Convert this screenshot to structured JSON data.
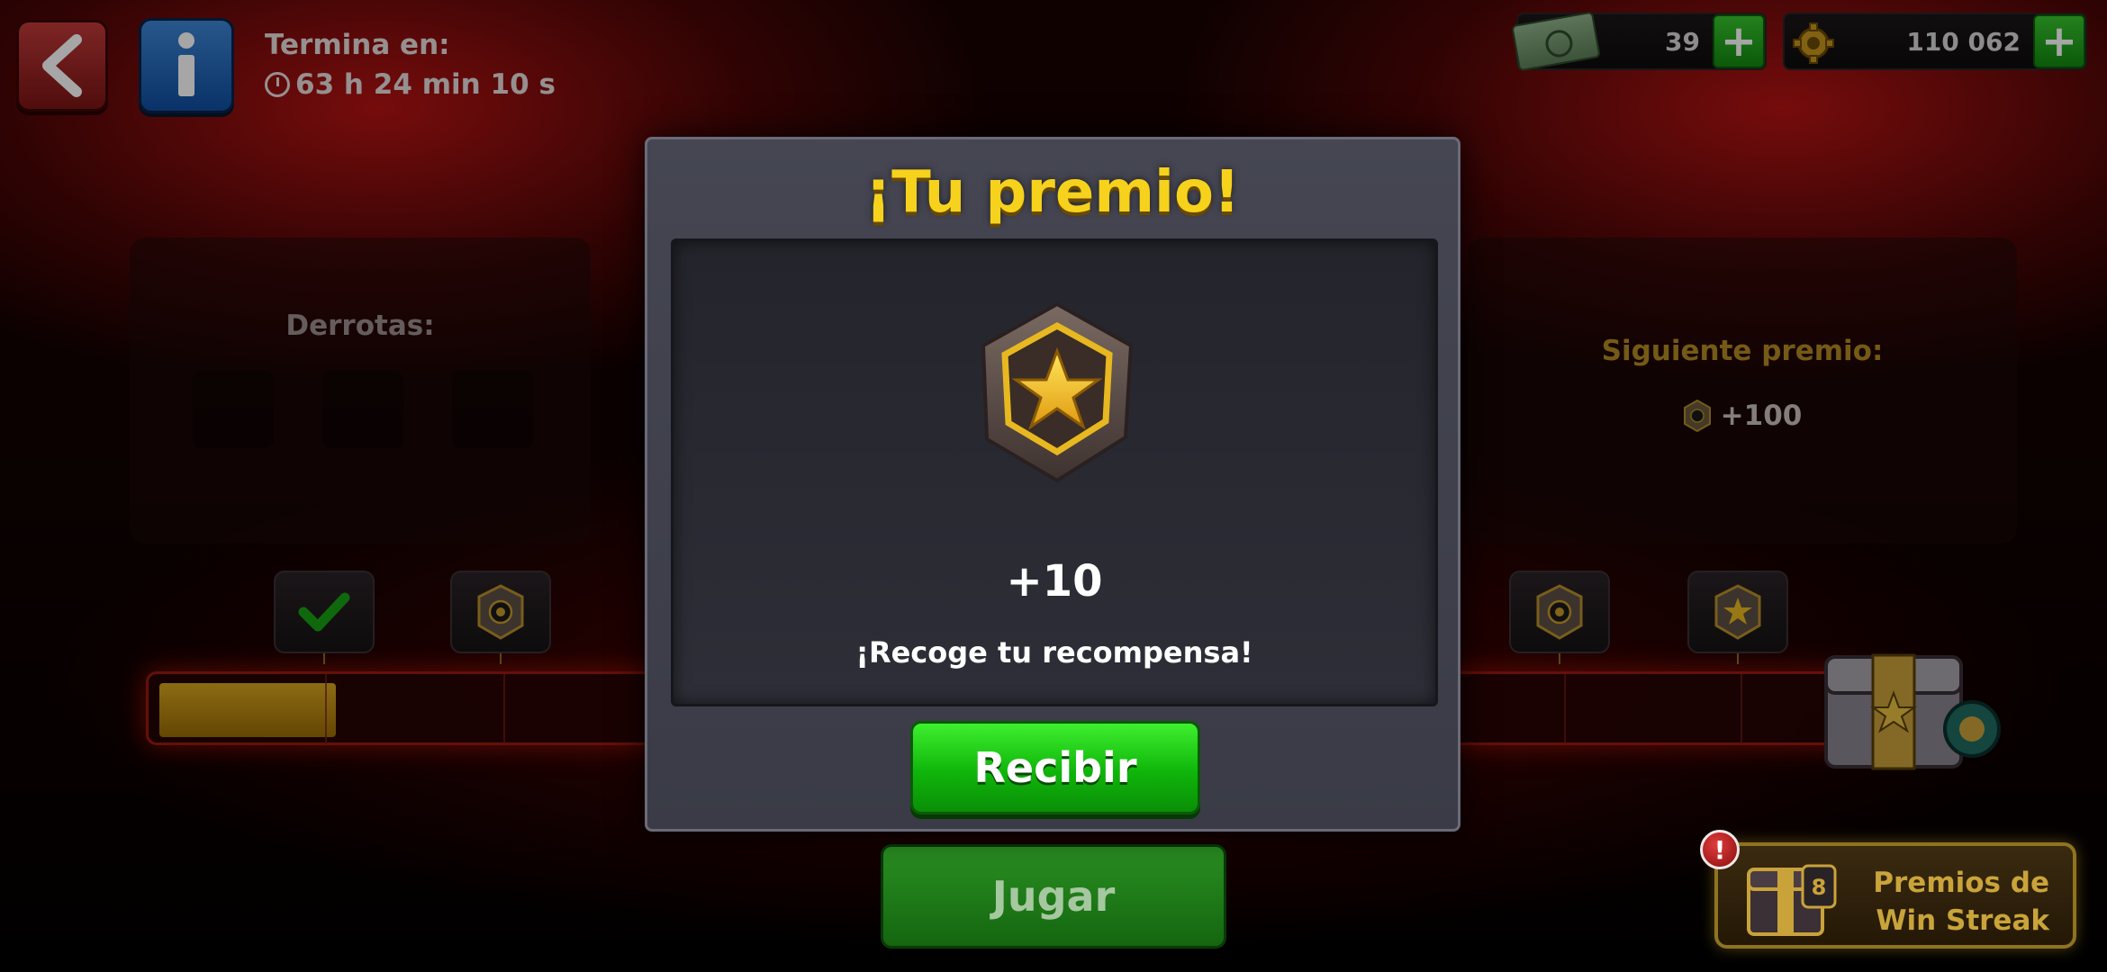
{
  "header": {
    "timer_label": "Termina en:",
    "timer_value": "63 h 24 min 10 s"
  },
  "currency": {
    "cash": "39",
    "coins": "110 062"
  },
  "left_panel": {
    "label": "Derrotas:"
  },
  "right_panel": {
    "label": "Siguiente premio:",
    "value": "+100"
  },
  "progress": {
    "filled_fraction": 0.07
  },
  "modal": {
    "title": "¡Tu premio!",
    "amount": "+10",
    "message": "¡Recoge tu recompensa!",
    "button": "Recibir"
  },
  "play_button": "Jugar",
  "win_streak": {
    "line1": "Premios de",
    "line2": "Win Streak",
    "alert": "!"
  },
  "colors": {
    "accent_green": "#0fb50a",
    "title_yellow": "#f6d21c",
    "red_back": "#c23a3a",
    "blue_info": "#0f4ea0"
  }
}
